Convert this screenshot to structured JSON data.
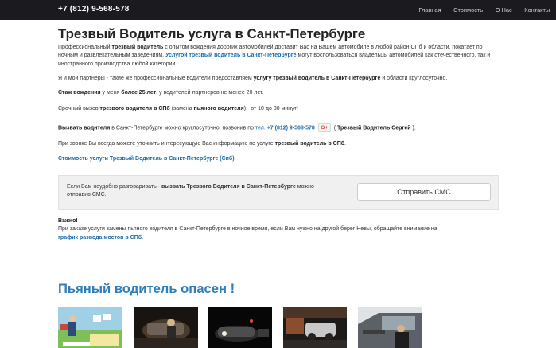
{
  "navbar": {
    "phone": "+7 (812) 9-568-578",
    "links": [
      "Главная",
      "Стоимость",
      "О Нас",
      "Контакты"
    ]
  },
  "page": {
    "title": "Трезвый Водитель услуга в Санкт-Петербурге"
  },
  "p1": {
    "t1": "Профессиональный ",
    "b1": "трезвый водитель",
    "t2": " с опытом вождения дорогих автомобилей доставит Вас на Вашем автомобиле в любой район СПб и области, покатает по ночным и развлекательным заведениям. ",
    "link": "Услугой трезвый водитель в Санкт-Петербурге",
    "t3": " могут воспользоваться владельцы автомобилей как отечественного, так и иностранного производства любой категории."
  },
  "p2": {
    "t1": "Я и мои партнеры - такие же профессиональные водители предоставляем ",
    "b1": "услугу трезвый водитель в Санкт-Петербурге",
    "t2": " и области круглосуточно."
  },
  "p3": {
    "b1": "Стаж вождения",
    "t1": " у меня ",
    "b2": "более 25 лет",
    "t2": ", у водителей-партнеров не менее 20 лет."
  },
  "p4": {
    "t1": "Срочный вызов ",
    "b1": "трезвого водителя в СПб",
    "t2": " (замена ",
    "b2": "пьяного водителя",
    "t3": ") - от 10 до 30 минут!"
  },
  "p5": {
    "b1": "Вызвать водителя",
    "t1": " в Санкт-Петербурге можно круглосуточно, позвонив по ",
    "tel_prefix": "тел.",
    "tel": "+7 (812) 9-568-578",
    "gplus": "G+",
    "t2": " ( ",
    "b2": "Трезвый Водитель Сергей",
    "t3": " )."
  },
  "p6": {
    "t1": "При звонке Вы всегда можете уточнить интересующую Вас информацию по услуге ",
    "b1": "трезвый водитель в СПб",
    "t2": "."
  },
  "price_link": "Стоимость услуги Трезвый Водитель в Санкт-Петербурге (Спб).",
  "sms": {
    "t1": "Если Вам неудобно разговаривать - ",
    "b1": "вызвать Трезвого Водителя в Санкт-Петербурге",
    "t2": " можно отправив СМС.",
    "button": "Отправить СМС"
  },
  "important": {
    "label": "Важно!",
    "t1": "При заказе услуги замены пьяного водителя в Санкт-Петербурге в ночное время, если Вам нужно на другой берег Невы, обращайте внимание на",
    "link": "график развода мостов в СПб."
  },
  "section_title": "Пьяный водитель опасен !",
  "colors": {
    "navbar_bg": "#1b1b1f",
    "link": "#1a6aa8",
    "section_title": "#2f7db9",
    "gplus": "#d23f31"
  }
}
